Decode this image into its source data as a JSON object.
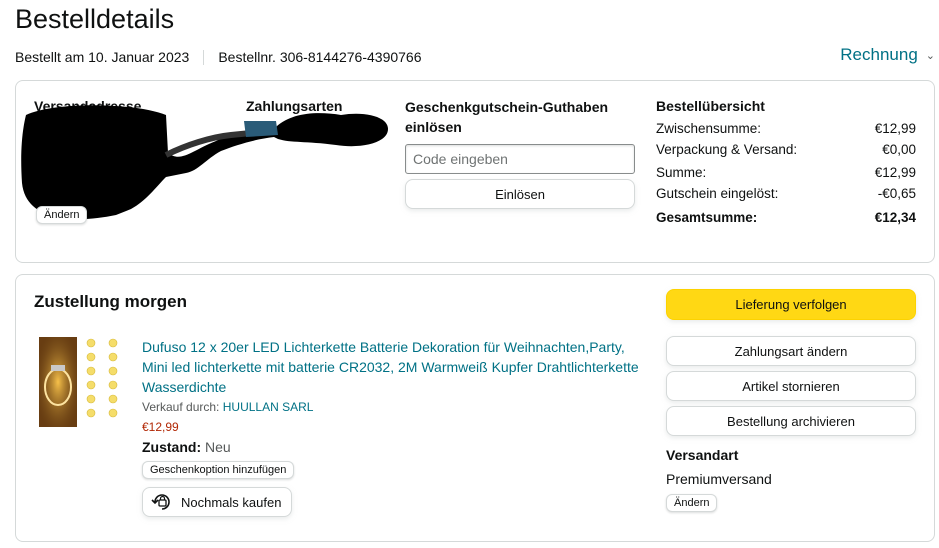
{
  "page": {
    "title": "Bestelldetails",
    "order_date": "Bestellt am 10. Januar 2023",
    "order_number": "Bestellnr. 306-8144276-4390766",
    "invoice_label": "Rechnung"
  },
  "address": {
    "heading": "Versandadresse",
    "change_label": "Ändern"
  },
  "payment": {
    "heading": "Zahlungsarten"
  },
  "gift_card": {
    "heading": "Geschenkgutschein-Guthaben einlösen",
    "placeholder": "Code eingeben",
    "redeem_label": "Einlösen"
  },
  "summary": {
    "heading": "Bestellübersicht",
    "rows": [
      {
        "label": "Zwischensumme:",
        "value": "€12,99"
      },
      {
        "label": "Verpackung & Versand:",
        "value": "€0,00"
      },
      {
        "label": "Summe:",
        "value": "€12,99"
      },
      {
        "label": "Gutschein eingelöst:",
        "value": "-€0,65"
      },
      {
        "label": "Gesamtsumme:",
        "value": "€12,34"
      }
    ]
  },
  "delivery": {
    "heading": "Zustellung morgen",
    "product": {
      "title": "Dufuso 12 x 20er LED Lichterkette Batterie Dekoration für Weihnachten,Party, Mini led lichterkette mit batterie CR2032, 2M Warmweiß Kupfer Drahtlichterkette Wasserdichte",
      "sold_by_label": "Verkauf durch:",
      "seller": "HUULLAN SARL",
      "price": "€12,99",
      "condition_label": "Zustand:",
      "condition_value": "Neu",
      "gift_option_label": "Geschenkoption hinzufügen",
      "buy_again_label": "Nochmals kaufen"
    },
    "actions": {
      "track": "Lieferung verfolgen",
      "change_payment": "Zahlungsart ändern",
      "cancel": "Artikel stornieren",
      "archive": "Bestellung archivieren"
    },
    "shipping": {
      "heading": "Versandart",
      "value": "Premiumversand",
      "change_label": "Ändern"
    }
  },
  "colors": {
    "link": "#007185",
    "price": "#b12704",
    "primary_button": "#ffd814",
    "border": "#d5d9d9"
  }
}
